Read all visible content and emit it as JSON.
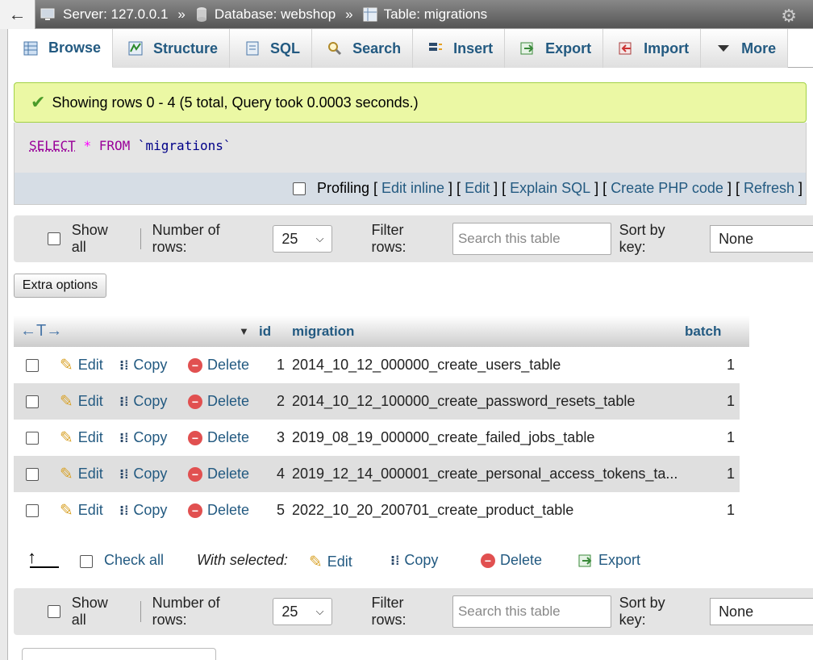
{
  "breadcrumb": {
    "back": "←",
    "server": "Server: 127.0.0.1",
    "database": "Database: webshop",
    "table": "Table: migrations",
    "sep": "»"
  },
  "tabs": [
    {
      "label": "Browse",
      "icon": "browse-icon"
    },
    {
      "label": "Structure",
      "icon": "structure-icon"
    },
    {
      "label": "SQL",
      "icon": "sql-icon"
    },
    {
      "label": "Search",
      "icon": "search-icon"
    },
    {
      "label": "Insert",
      "icon": "insert-icon"
    },
    {
      "label": "Export",
      "icon": "export-icon"
    },
    {
      "label": "Import",
      "icon": "import-icon"
    },
    {
      "label": "More",
      "icon": "more-icon"
    }
  ],
  "message": {
    "text": "Showing rows 0 - 4 (5 total, Query took 0.0003 seconds.)"
  },
  "sql": {
    "select": "SELECT",
    "star": "*",
    "from": "FROM",
    "table": "`migrations`"
  },
  "sql_links": {
    "profiling": "Profiling",
    "edit_inline": "Edit inline",
    "edit": "Edit",
    "explain": "Explain SQL",
    "php": "Create PHP code",
    "refresh": "Refresh"
  },
  "navbar": {
    "show_all": "Show all",
    "num_rows_label": "Number of rows:",
    "num_rows_value": "25",
    "filter_label": "Filter rows:",
    "filter_placeholder": "Search this table",
    "sort_label": "Sort by key:",
    "sort_value": "None"
  },
  "extra_options": "Extra options",
  "table": {
    "columns": {
      "id": "id",
      "migration": "migration",
      "batch": "batch"
    },
    "actions": {
      "edit": "Edit",
      "copy": "Copy",
      "delete": "Delete"
    },
    "rows": [
      {
        "id": "1",
        "migration": "2014_10_12_000000_create_users_table",
        "batch": "1"
      },
      {
        "id": "2",
        "migration": "2014_10_12_100000_create_password_resets_table",
        "batch": "1"
      },
      {
        "id": "3",
        "migration": "2019_08_19_000000_create_failed_jobs_table",
        "batch": "1"
      },
      {
        "id": "4",
        "migration": "2019_12_14_000001_create_personal_access_tokens_ta...",
        "batch": "1"
      },
      {
        "id": "5",
        "migration": "2022_10_20_200701_create_product_table",
        "batch": "1"
      }
    ]
  },
  "bulk": {
    "check_all": "Check all",
    "with_selected": "With selected:",
    "edit": "Edit",
    "copy": "Copy",
    "delete": "Delete",
    "export": "Export"
  }
}
